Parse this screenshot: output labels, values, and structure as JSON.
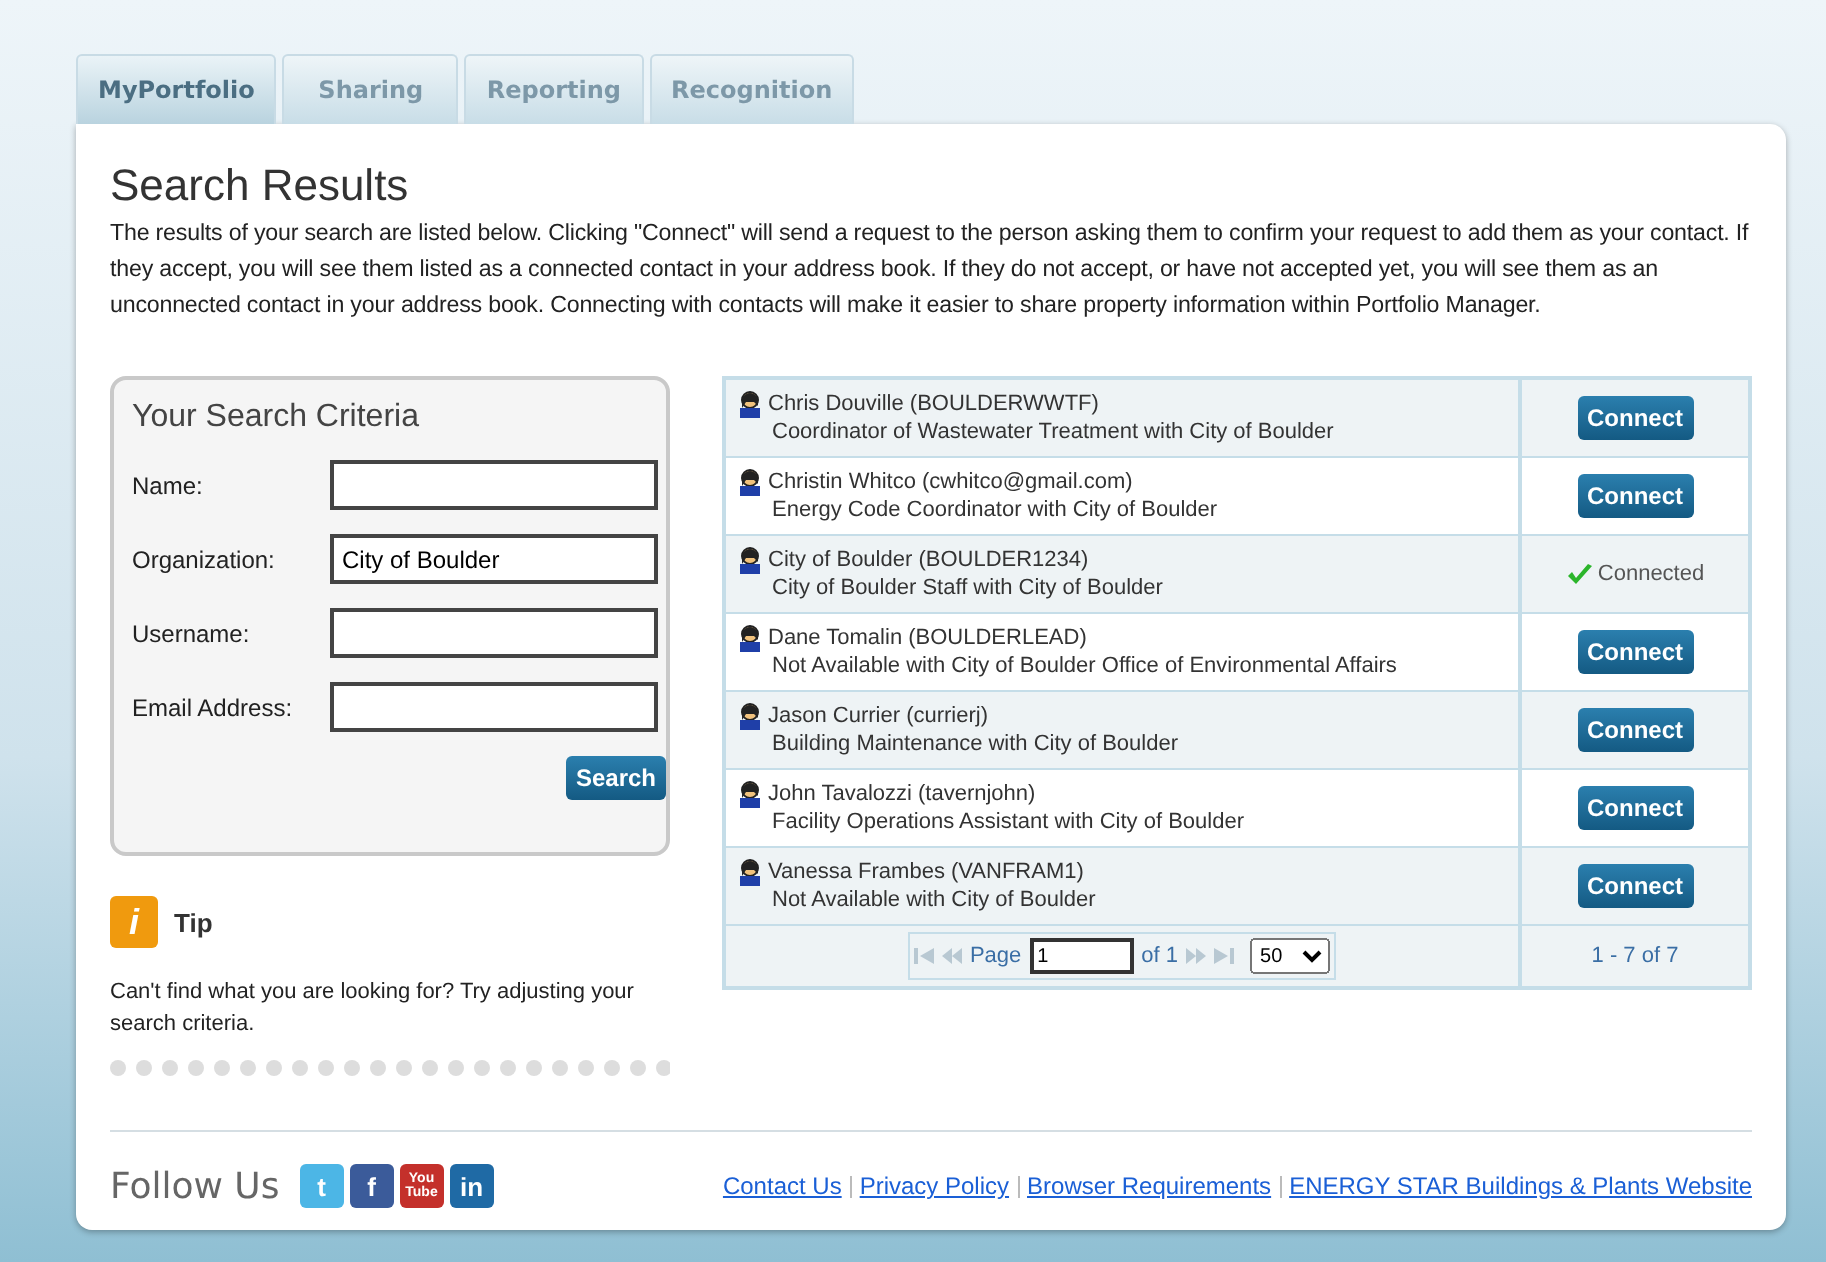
{
  "tabs": [
    {
      "label": "MyPortfolio",
      "selected": true
    },
    {
      "label": "Sharing",
      "selected": false
    },
    {
      "label": "Reporting",
      "selected": false
    },
    {
      "label": "Recognition",
      "selected": false
    }
  ],
  "title": "Search Results",
  "intro": "The results of your search are listed below. Clicking \"Connect\" will send a request to the person asking them to confirm your request to add them as your contact. If they accept, you will see them listed as a connected contact in your address book. If they do not accept, or have not accepted yet, you will see them as an unconnected contact in your address book. Connecting with contacts will make it easier to share property information within Portfolio Manager.",
  "criteria": {
    "title": "Your Search Criteria",
    "fields": [
      {
        "label": "Name:"
      },
      {
        "label": "Organization:",
        "value": "City of Boulder"
      },
      {
        "label": "Username:"
      },
      {
        "label": "Email Address:"
      }
    ],
    "button": "Search"
  },
  "tip": {
    "icon": "i",
    "title": "Tip",
    "text": "Can't find what you are looking for? Try adjusting your search criteria."
  },
  "results": [
    {
      "name": "Chris Douville (BOULDERWWTF)",
      "detail": "Coordinator of Wastewater Treatment with City of Boulder",
      "connected": false,
      "action": "Connect"
    },
    {
      "name": "Christin Whitco (cwhitco@gmail.com)",
      "detail": "Energy Code Coordinator with City of Boulder",
      "connected": false,
      "action": "Connect"
    },
    {
      "name": "City of Boulder (BOULDER1234)",
      "detail": "City of Boulder Staff with City of Boulder",
      "connected": true,
      "action": "Connected"
    },
    {
      "name": "Dane Tomalin (BOULDERLEAD)",
      "detail": "Not Available with City of Boulder Office of Environmental Affairs",
      "connected": false,
      "action": "Connect"
    },
    {
      "name": "Jason Currier (currierj)",
      "detail": "Building Maintenance with City of Boulder",
      "connected": false,
      "action": "Connect"
    },
    {
      "name": "John Tavalozzi (tavernjohn)",
      "detail": "Facility Operations Assistant with City of Boulder",
      "connected": false,
      "action": "Connect"
    },
    {
      "name": "Vanessa Frambes (VANFRAM1)",
      "detail": "Not Available with City of Boulder",
      "connected": false,
      "action": "Connect"
    }
  ],
  "pager": {
    "page_label": "Page",
    "page": "1",
    "of": "of 1",
    "page_size": "50",
    "summary": "1 - 7 of 7"
  },
  "footer": {
    "follow": "Follow Us",
    "social": [
      {
        "kind": "twitter",
        "glyph": "t"
      },
      {
        "kind": "facebook",
        "glyph": "f"
      },
      {
        "kind": "youtube",
        "glyph": "You Tube"
      },
      {
        "kind": "linkedin",
        "glyph": "in"
      }
    ],
    "links": [
      "Contact Us",
      "Privacy Policy",
      "Browser Requirements",
      "ENERGY STAR Buildings & Plants Website"
    ]
  }
}
